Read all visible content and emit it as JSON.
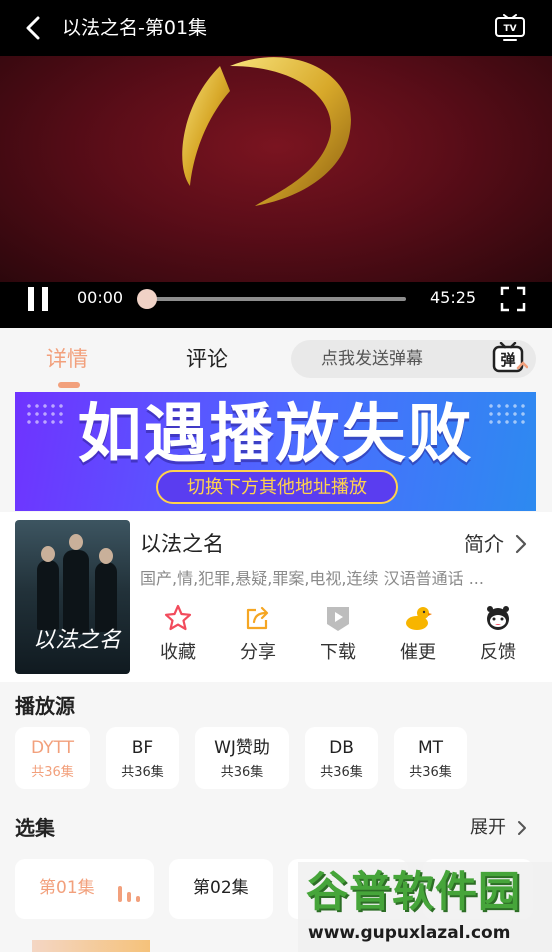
{
  "header": {
    "title": "以法之名-第01集"
  },
  "player": {
    "current_time": "00:00",
    "total_time": "45:25",
    "progress": 0
  },
  "tabs": [
    {
      "label": "详情",
      "active": true
    },
    {
      "label": "评论",
      "active": false
    }
  ],
  "danmu": {
    "placeholder": "点我发送弹幕",
    "icon_text": "弹"
  },
  "banner": {
    "headline": "如遇播放失败",
    "subtext": "切换下方其他地址播放"
  },
  "show": {
    "poster_text": "以法之名",
    "title": "以法之名",
    "intro_label": "简介",
    "tags": "国产,情,犯罪,悬疑,罪案,电视,连续 汉语普通话 ..."
  },
  "actions": [
    {
      "label": "收藏",
      "icon": "star-icon"
    },
    {
      "label": "分享",
      "icon": "share-icon"
    },
    {
      "label": "下载",
      "icon": "download-icon"
    },
    {
      "label": "催更",
      "icon": "duck-icon"
    },
    {
      "label": "反馈",
      "icon": "feedback-icon"
    }
  ],
  "sources": {
    "title": "播放源",
    "items": [
      {
        "name": "DYTT",
        "count": "共36集",
        "active": true
      },
      {
        "name": "BF",
        "count": "共36集",
        "active": false
      },
      {
        "name": "WJ赞助",
        "count": "共36集",
        "active": false
      },
      {
        "name": "DB",
        "count": "共36集",
        "active": false
      },
      {
        "name": "MT",
        "count": "共36集",
        "active": false
      }
    ]
  },
  "episodes": {
    "title": "选集",
    "expand_label": "展开",
    "items": [
      {
        "label": "第01集",
        "active": true
      },
      {
        "label": "第02集",
        "active": false
      }
    ]
  },
  "watermark": {
    "name": "谷普软件园",
    "url": "www.gupuxlazal.com"
  },
  "colors": {
    "accent": "#f2a07c",
    "video_bg": "#6a0f1c",
    "banner": "#4b6cff"
  }
}
